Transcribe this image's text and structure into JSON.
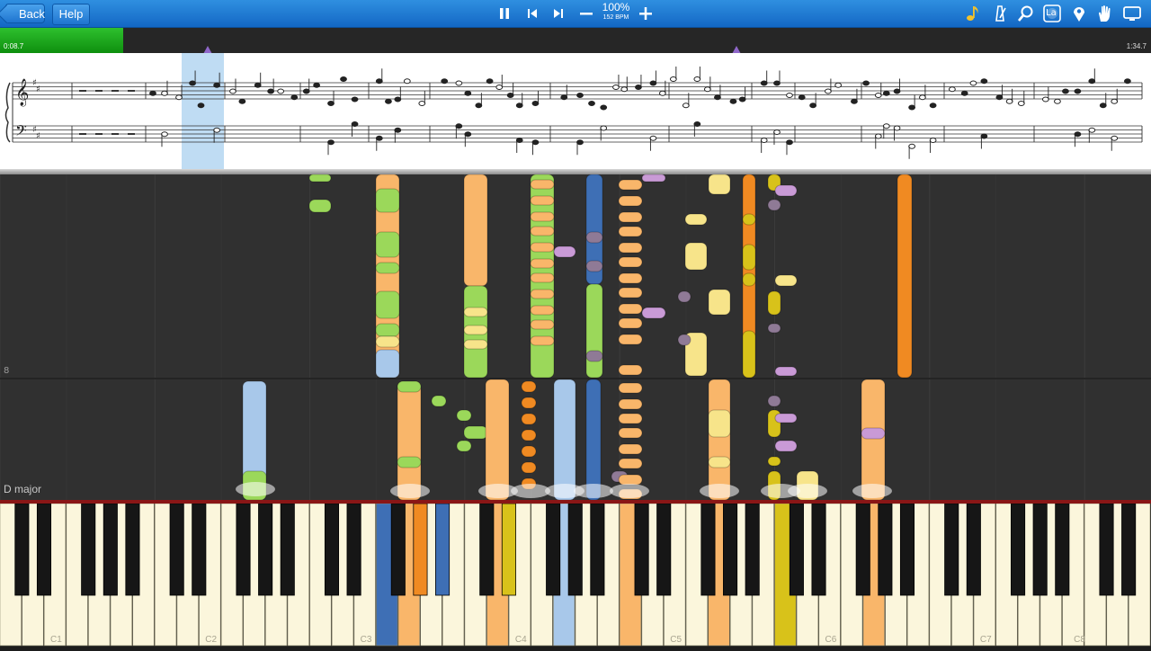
{
  "toolbar": {
    "back_label": "Back",
    "help_label": "Help",
    "speed_percent": "100%",
    "bpm": "152 BPM",
    "icons": [
      "pause-icon",
      "skip-back-icon",
      "skip-forward-icon",
      "minus-icon",
      "plus-icon",
      "music-note-icon",
      "metronome-icon",
      "zoom-icon",
      "note-label-icon",
      "location-pin-icon",
      "hand-icon",
      "screen-icon"
    ],
    "note_label_text": "La"
  },
  "progress": {
    "elapsed": "0:08.7",
    "total": "1:34.7",
    "fraction": 0.107
  },
  "score": {
    "clefs": [
      "treble-clef",
      "bass-clef"
    ],
    "key_signature": "D major sharps"
  },
  "roll": {
    "measure_number": "8",
    "key_label": "D major"
  },
  "keyboard": {
    "octave_labels": [
      "C1",
      "C2",
      "C3",
      "C4",
      "C5",
      "C6",
      "C7",
      "C8"
    ]
  },
  "colors": {
    "toolbar": "#1e74cf",
    "progress_fill": "#22b022",
    "orange": "#f9b66a",
    "orange_dark": "#f08a22",
    "green": "#9bd85a",
    "blue": "#a8c8ea",
    "blue_dark": "#3e6fb5",
    "yellow": "#f7e48a",
    "yellow_dark": "#d8c21a",
    "lavender": "#c99ad6",
    "mauve": "#8f7a96"
  }
}
